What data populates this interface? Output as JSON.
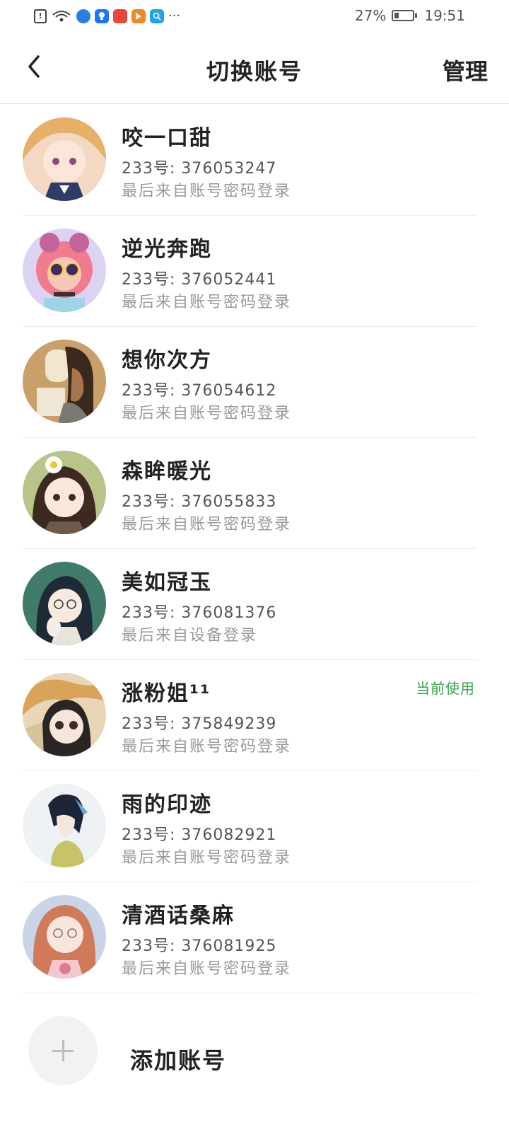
{
  "status_bar": {
    "battery_percent": "27%",
    "time": "19:51",
    "icons": [
      "alert-icon",
      "wifi-icon",
      "app-icon-blue",
      "app-icon-bulb",
      "app-icon-red",
      "app-icon-orange",
      "app-icon-search",
      "more-icon"
    ],
    "more": "···"
  },
  "header": {
    "back_icon": "back-chevron-icon",
    "back_glyph": "‹",
    "title": "切换账号",
    "manage_label": "管理"
  },
  "accounts": [
    {
      "name": "咬一口甜",
      "uid": "233号: 376053247",
      "login": "最后来自账号密码登录",
      "current": ""
    },
    {
      "name": "逆光奔跑",
      "uid": "233号: 376052441",
      "login": "最后来自账号密码登录",
      "current": ""
    },
    {
      "name": "想你次方",
      "uid": "233号: 376054612",
      "login": "最后来自账号密码登录",
      "current": ""
    },
    {
      "name": "森眸暖光",
      "uid": "233号: 376055833",
      "login": "最后来自账号密码登录",
      "current": ""
    },
    {
      "name": "美如冠玉",
      "uid": "233号: 376081376",
      "login": "最后来自设备登录",
      "current": ""
    },
    {
      "name": "涨粉姐¹¹",
      "uid": "233号: 375849239",
      "login": "最后来自账号密码登录",
      "current": "当前使用"
    },
    {
      "name": "雨的印迹",
      "uid": "233号: 376082921",
      "login": "最后来自账号密码登录",
      "current": ""
    },
    {
      "name": "清酒话桑麻",
      "uid": "233号: 376081925",
      "login": "最后来自账号密码登录",
      "current": ""
    }
  ],
  "add_account": {
    "label": "添加账号",
    "icon": "plus-icon"
  },
  "colors": {
    "current_badge": "#3aa24a",
    "secondary_text": "#9a9a9a",
    "divider": "#ececec"
  }
}
